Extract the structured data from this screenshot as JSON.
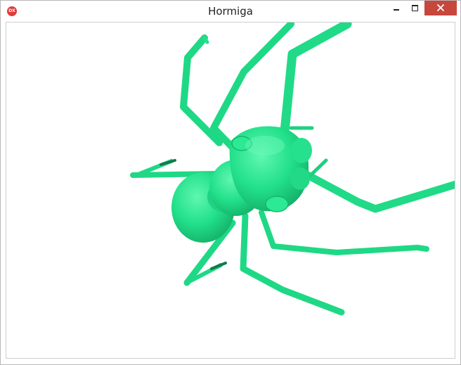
{
  "window": {
    "title": "Hormiga",
    "app_icon_label": "DX",
    "controls": {
      "minimize": "minimize-icon",
      "maximize": "maximize-icon",
      "close": "close-icon"
    },
    "colors": {
      "close_button": "#c7473d",
      "ant_body": "#22e08a",
      "ant_shadow": "#169e60"
    }
  }
}
